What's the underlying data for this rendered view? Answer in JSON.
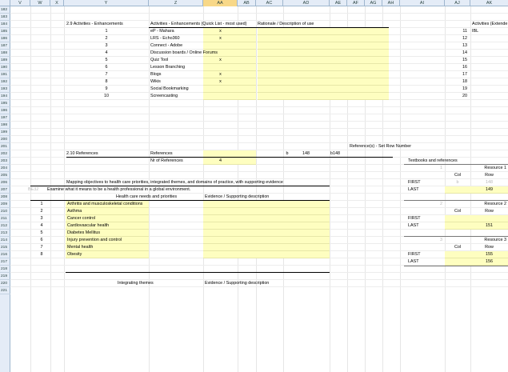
{
  "columns": [
    "V",
    "W",
    "X",
    "Y",
    "Z",
    "AA",
    "AB",
    "AC",
    "AD",
    "AE",
    "AF",
    "AG",
    "AH",
    "AI",
    "AJ",
    "AK"
  ],
  "row_numbers": [
    "182",
    "183",
    "184",
    "185",
    "186",
    "187",
    "188",
    "189",
    "190",
    "191",
    "192",
    "193",
    "194",
    "195",
    "196",
    "197",
    "198",
    "199",
    "200",
    "201",
    "202",
    "203",
    "204",
    "205",
    "206",
    "207",
    "208",
    "209",
    "210",
    "211",
    "212",
    "213",
    "214",
    "215",
    "216",
    "217",
    "218",
    "219",
    "220",
    "221"
  ],
  "enh": {
    "section": "2.9 Activities - Enhancements",
    "col_header": "Activities - Enhancements (Quick List - most used)",
    "rationale_header": "Rationale / Description of use",
    "ak_header": "Activities (Extende",
    "ak_first": "IBL",
    "items": [
      {
        "n": "1",
        "name": "eP - Mahara",
        "mark": "x",
        "aj": "11"
      },
      {
        "n": "2",
        "name": "LRS - Echo360",
        "mark": "x",
        "aj": "12"
      },
      {
        "n": "3",
        "name": "Connect - Adobe",
        "mark": "",
        "aj": "13"
      },
      {
        "n": "4",
        "name": "Discussion boards / Online Forums",
        "mark": "",
        "aj": "14"
      },
      {
        "n": "5",
        "name": "Quiz Tool",
        "mark": "x",
        "aj": "15"
      },
      {
        "n": "6",
        "name": "Lesson Branching",
        "mark": "",
        "aj": "16"
      },
      {
        "n": "7",
        "name": "Blogs",
        "mark": "x",
        "aj": "17"
      },
      {
        "n": "8",
        "name": "Wikis",
        "mark": "x",
        "aj": "18"
      },
      {
        "n": "9",
        "name": "Social Bookmarking",
        "mark": "",
        "aj": "19"
      },
      {
        "n": "10",
        "name": "Screencasting",
        "mark": "",
        "aj": "20"
      }
    ]
  },
  "refs": {
    "set_row_label": "Reference(s) - Set Row Number",
    "section": "2.10 References",
    "label_refs": "References",
    "label_nr": "Nr of References",
    "nr_value": "4",
    "ac_value": "b",
    "ad_value": "148",
    "ae_value": "b148",
    "textbooks": "Textbooks and references",
    "resources": [
      {
        "idx": "1",
        "title": "Resource 1",
        "col": "b",
        "row": "148",
        "last_row": "149"
      },
      {
        "idx": "2",
        "title": "Resource 2",
        "col": "",
        "row": "",
        "last_row": "151"
      },
      {
        "idx": "3",
        "title": "Resource 3",
        "col": "",
        "row": "",
        "first_row": "155",
        "last_row": "156"
      }
    ],
    "col_label": "Col",
    "row_label": "Row",
    "first_label": "FIRST",
    "last_label": "LAST"
  },
  "mapping": {
    "title": "Mapping objectives to health care priorities, integrated themes, and domains of practice, with supporting evidence",
    "code": "BE32",
    "objective": "Examine what it means to be a health professional in a global environment.",
    "needs_header": "Health care needs and priorities",
    "evidence_header": "Evidence / Supporting description",
    "items": [
      {
        "n": "1",
        "name": "Arthritis and musculoskeletal conditions"
      },
      {
        "n": "2",
        "name": "Asthma"
      },
      {
        "n": "3",
        "name": "Cancer control"
      },
      {
        "n": "4",
        "name": "Cardiovascular health"
      },
      {
        "n": "5",
        "name": "Diabetes Mellitus"
      },
      {
        "n": "6",
        "name": "Injury prevention and control"
      },
      {
        "n": "7",
        "name": "Mental health"
      },
      {
        "n": "8",
        "name": "Obesity"
      }
    ],
    "themes_header": "Integrating themes",
    "evidence_header2": "Evidence / Supporting description"
  }
}
